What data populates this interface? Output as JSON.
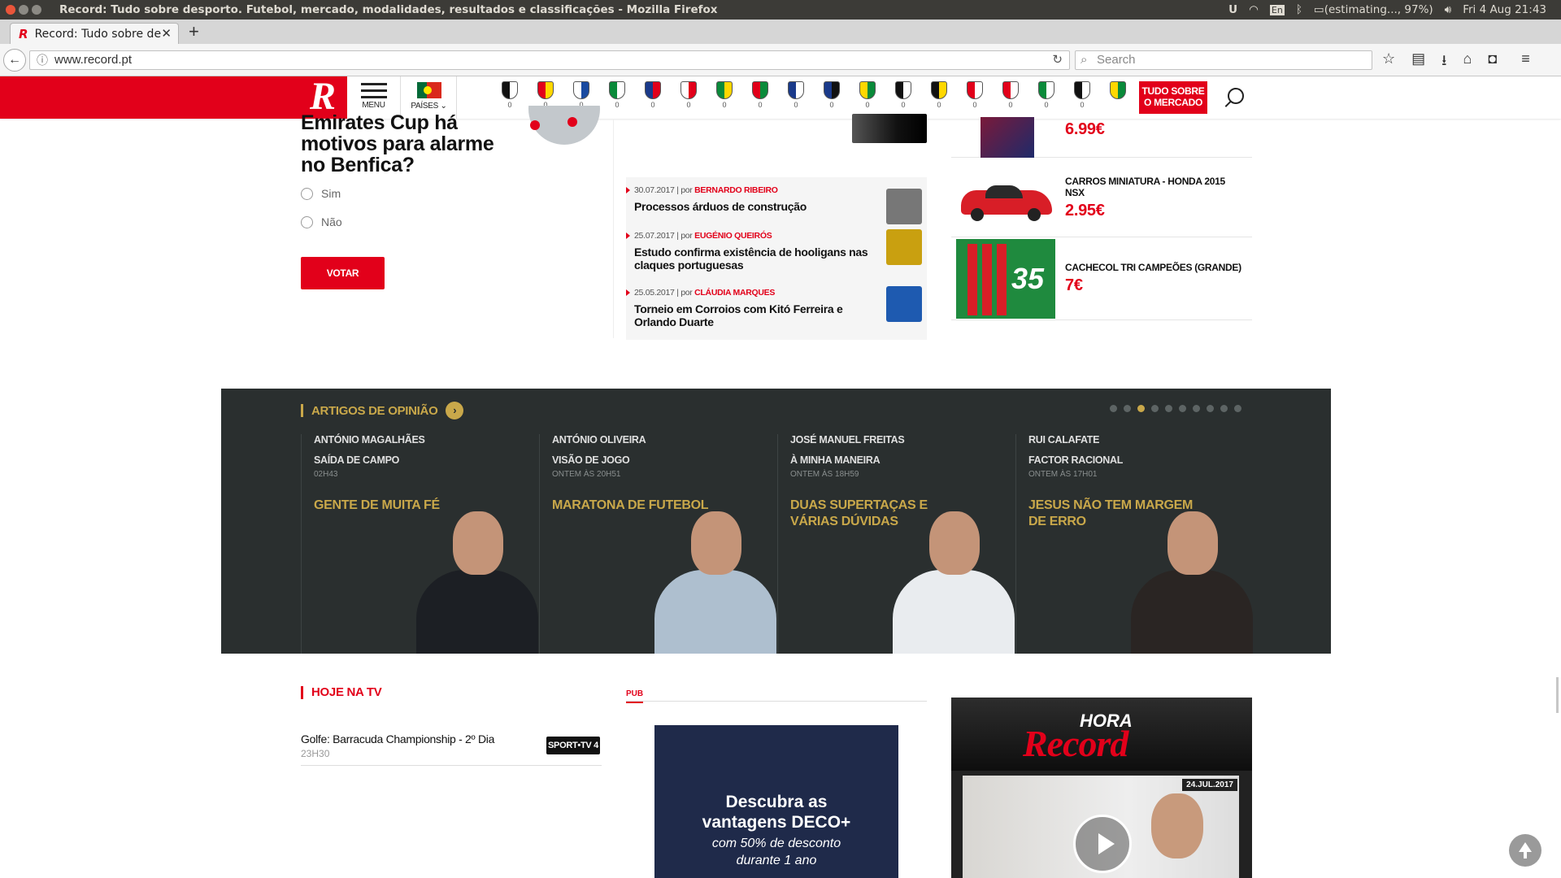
{
  "os": {
    "title": "Record: Tudo sobre desporto. Futebol, mercado, modalidades, resultados e classificações - Mozilla Firefox",
    "keyboard": "En",
    "battery": "(estimating..., 97%)",
    "clock": "Fri  4 Aug 21:43"
  },
  "browser": {
    "tab_title": "Record: Tudo sobre de",
    "url": "www.record.pt",
    "search_placeholder": "Search"
  },
  "header": {
    "menu_label": "MENU",
    "countries_label": "PAÍSES ⌄",
    "tudo_label_1": "TUDO SOBRE",
    "tudo_label_2": "O MERCADO",
    "clubs": [
      {
        "score": "0",
        "c1": "#111",
        "c2": "#fff"
      },
      {
        "score": "0",
        "c1": "#e2001a",
        "c2": "#ffd700"
      },
      {
        "score": "0",
        "c1": "#fff",
        "c2": "#1a4aa0"
      },
      {
        "score": "0",
        "c1": "#0a8a3a",
        "c2": "#fff"
      },
      {
        "score": "0",
        "c1": "#1a3a8a",
        "c2": "#e2001a"
      },
      {
        "score": "0",
        "c1": "#fff",
        "c2": "#e2001a"
      },
      {
        "score": "0",
        "c1": "#0a8a3a",
        "c2": "#ffd700"
      },
      {
        "score": "0",
        "c1": "#e2001a",
        "c2": "#0a8a3a"
      },
      {
        "score": "0",
        "c1": "#1a3a8a",
        "c2": "#fff"
      },
      {
        "score": "0",
        "c1": "#1a3a8a",
        "c2": "#111"
      },
      {
        "score": "0",
        "c1": "#ffd700",
        "c2": "#0a8a3a"
      },
      {
        "score": "0",
        "c1": "#111",
        "c2": "#fff"
      },
      {
        "score": "0",
        "c1": "#111",
        "c2": "#ffd700"
      },
      {
        "score": "0",
        "c1": "#e2001a",
        "c2": "#fff"
      },
      {
        "score": "0",
        "c1": "#e2001a",
        "c2": "#fff"
      },
      {
        "score": "0",
        "c1": "#0a8a3a",
        "c2": "#fff"
      },
      {
        "score": "0",
        "c1": "#111",
        "c2": "#fff"
      },
      {
        "score": "",
        "c1": "#ffd700",
        "c2": "#0a8a3a"
      }
    ]
  },
  "poll": {
    "question": "Emirates Cup há motivos para alarme no Benfica?",
    "options": [
      "Sim",
      "Não"
    ],
    "vote_label": "VOTAR"
  },
  "news": [
    {
      "date": "30.07.2017",
      "by_prefix": "| por",
      "author": "BERNARDO RIBEIRO",
      "headline": "Processos árduos de construção",
      "thumb": "#777"
    },
    {
      "date": "25.07.2017",
      "by_prefix": "| por",
      "author": "EUGÉNIO QUEIRÓS",
      "headline": "Estudo confirma existência de hooligans nas claques portuguesas",
      "thumb": "#c9a010"
    },
    {
      "date": "25.05.2017",
      "by_prefix": "| por",
      "author": "CLÁUDIA MARQUES",
      "headline": "Torneio em Corroios com Kitó Ferreira e Orlando Duarte",
      "thumb": "#1e5ab0"
    }
  ],
  "store": [
    {
      "name": "",
      "price": "6.99€"
    },
    {
      "name": "CARROS MINIATURA - HONDA 2015 NSX",
      "price": "2.95€"
    },
    {
      "name": "CACHECOL TRI CAMPEÕES (GRANDE)",
      "price": "7€"
    }
  ],
  "opinion": {
    "title": "ARTIGOS DE OPINIÃO",
    "active_dot": 2,
    "dot_count": 10,
    "columns": [
      {
        "author": "ANTÓNIO MAGALHÃES",
        "section": "SAÍDA DE CAMPO",
        "time": "02H43",
        "article": "GENTE DE MUITA FÉ",
        "suit": "#1c1f24"
      },
      {
        "author": "ANTÓNIO OLIVEIRA",
        "section": "VISÃO DE JOGO",
        "time": "ONTEM ÀS 20H51",
        "article": "MARATONA DE FUTEBOL",
        "suit": "#aebfcf"
      },
      {
        "author": "JOSÉ MANUEL FREITAS",
        "section": "À MINHA MANEIRA",
        "time": "ONTEM ÀS 18H59",
        "article": "DUAS SUPERTAÇAS E VÁRIAS DÚVIDAS",
        "suit": "#e9ecef"
      },
      {
        "author": "RUI CALAFATE",
        "section": "FACTOR RACIONAL",
        "time": "ONTEM ÀS 17H01",
        "article": "JESUS NÃO TEM MARGEM DE ERRO",
        "suit": "#2a2523"
      }
    ]
  },
  "tv": {
    "title": "HOJE NA TV",
    "program": "Golfe: Barracuda Championship - 2º Dia",
    "time": "23H30",
    "channel": "SPORT•TV 4"
  },
  "pub": {
    "label": "PUB",
    "ad_line1": "Descubra as",
    "ad_line2": "vantagens DECO+",
    "ad_line3": "com 50% de desconto",
    "ad_line4": "durante 1 ano"
  },
  "hora": {
    "word1": "HORA",
    "word2": "Record",
    "date": "24.JUL.2017"
  }
}
